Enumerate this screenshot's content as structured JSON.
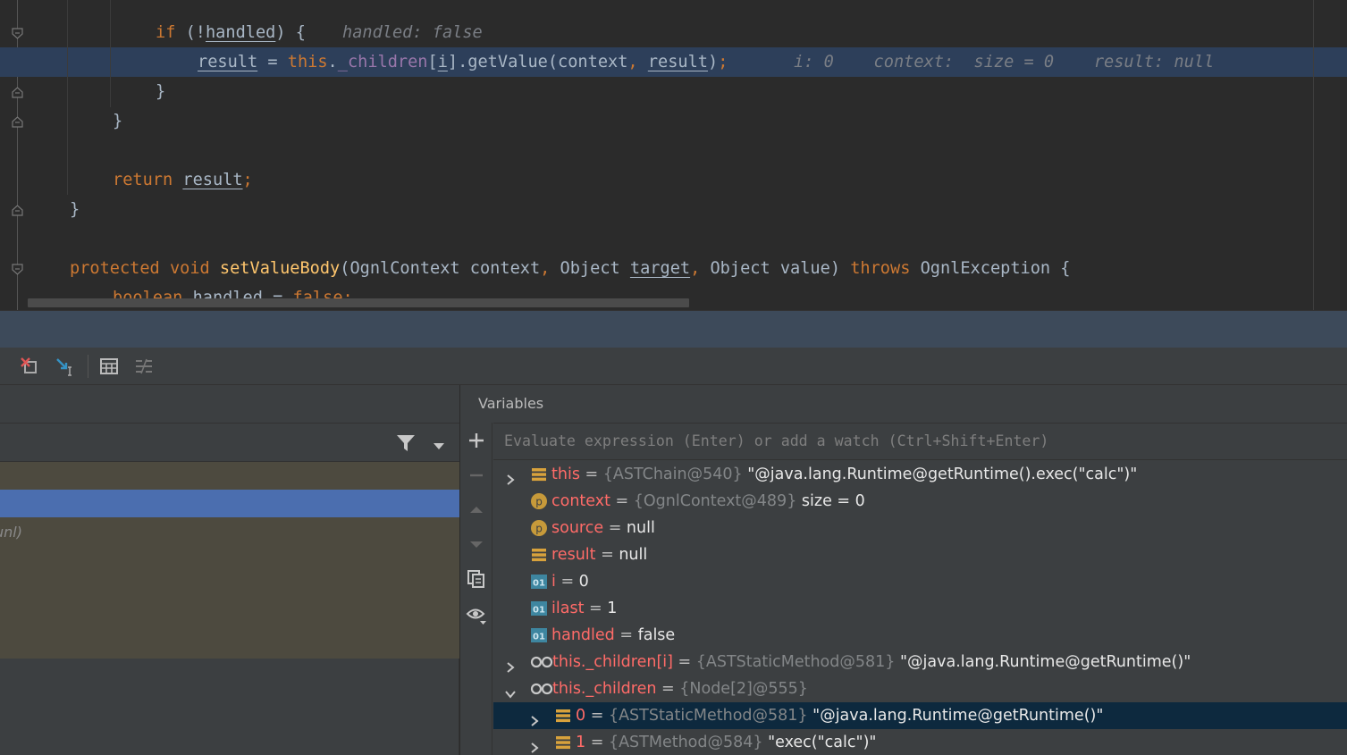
{
  "editor": {
    "lines": [
      {
        "id": "l1",
        "parts": [
          [
            "kw",
            "if"
          ],
          [
            "t",
            " (!"
          ],
          [
            "ul",
            "handled"
          ],
          [
            "t",
            ") {"
          ]
        ],
        "hint": "handled: false"
      },
      {
        "id": "l2",
        "parts": [
          [
            "ul",
            "result"
          ],
          [
            "t",
            " = "
          ],
          [
            "kw",
            "this"
          ],
          [
            "t",
            "."
          ],
          [
            "fld",
            "_children"
          ],
          [
            "t",
            "["
          ],
          [
            "ul",
            "i"
          ],
          [
            "t",
            "].getValue(context"
          ],
          [
            "kw",
            ","
          ],
          [
            "t",
            " "
          ],
          [
            "ul",
            "result"
          ],
          [
            "t",
            ")"
          ],
          [
            "kw",
            ";"
          ]
        ],
        "hint": "i: 0    context:  size = 0    result: null"
      },
      {
        "id": "l3",
        "parts": [
          [
            "t",
            "}"
          ]
        ]
      },
      {
        "id": "l4",
        "parts": [
          [
            "t",
            "}"
          ]
        ]
      },
      {
        "id": "l5",
        "parts": []
      },
      {
        "id": "l6",
        "parts": [
          [
            "kw",
            "return"
          ],
          [
            "t",
            " "
          ],
          [
            "ul",
            "result"
          ],
          [
            "kw",
            ";"
          ]
        ]
      },
      {
        "id": "l7",
        "parts": [
          [
            "t",
            "}"
          ]
        ]
      },
      {
        "id": "l8",
        "parts": []
      },
      {
        "id": "l9",
        "parts": [
          [
            "kw",
            "protected void "
          ],
          [
            "fn",
            "setValueBody"
          ],
          [
            "t",
            "(OgnlContext context"
          ],
          [
            "kw",
            ","
          ],
          [
            "t",
            " Object "
          ],
          [
            "ul",
            "target"
          ],
          [
            "kw",
            ","
          ],
          [
            "t",
            " Object value) "
          ],
          [
            "kw",
            "throws"
          ],
          [
            "t",
            " OgnlException {"
          ]
        ]
      },
      {
        "id": "l10",
        "parts": [
          [
            "kw",
            "boolean"
          ],
          [
            "t",
            " "
          ],
          [
            "ul",
            "handled"
          ],
          [
            "t",
            " = "
          ],
          [
            "kw",
            "false;"
          ]
        ]
      }
    ]
  },
  "frames": {
    "partial_row_text": "unl)"
  },
  "variables": {
    "title": "Variables",
    "eval_placeholder": "Evaluate expression (Enter) or add a watch (Ctrl+Shift+Enter)",
    "rows": [
      {
        "arrow": "right",
        "icon": "field-icon",
        "name": "this",
        "type": "{ASTChain@540}",
        "value": "\"@java.lang.Runtime@getRuntime().exec(\"calc\")\""
      },
      {
        "arrow": "",
        "icon": "parameter-icon",
        "name": "context",
        "type": "{OgnlContext@489}",
        "value": " size = 0"
      },
      {
        "arrow": "",
        "icon": "parameter-icon",
        "name": "source",
        "type": "",
        "value": "null"
      },
      {
        "arrow": "",
        "icon": "field-icon",
        "name": "result",
        "type": "",
        "value": "null"
      },
      {
        "arrow": "",
        "icon": "primitive-icon",
        "name": "i",
        "type": "",
        "value": "0"
      },
      {
        "arrow": "",
        "icon": "primitive-icon",
        "name": "ilast",
        "type": "",
        "value": "1"
      },
      {
        "arrow": "",
        "icon": "primitive-icon",
        "name": "handled",
        "type": "",
        "value": "false"
      },
      {
        "arrow": "right",
        "icon": "watch-icon",
        "name": "this._children[i]",
        "type": "{ASTStaticMethod@581}",
        "value": "\"@java.lang.Runtime@getRuntime()\""
      },
      {
        "arrow": "down",
        "icon": "watch-icon",
        "name": "this._children",
        "type": "{Node[2]@555}",
        "value": ""
      },
      {
        "arrow": "right",
        "icon": "field-icon",
        "name": "0",
        "type": "{ASTStaticMethod@581}",
        "value": "\"@java.lang.Runtime@getRuntime()\"",
        "child": true,
        "selected": true
      },
      {
        "arrow": "right",
        "icon": "field-icon",
        "name": "1",
        "type": "{ASTMethod@584}",
        "value": "\"exec(\"calc\")\"",
        "child": true
      }
    ]
  },
  "colors": {
    "editor_bg": "#2b2b2b",
    "keyword": "#cc7832",
    "method": "#ffc66d",
    "field": "#9876aa",
    "var_name": "#ff6b68",
    "selection": "#4b6eaf"
  }
}
